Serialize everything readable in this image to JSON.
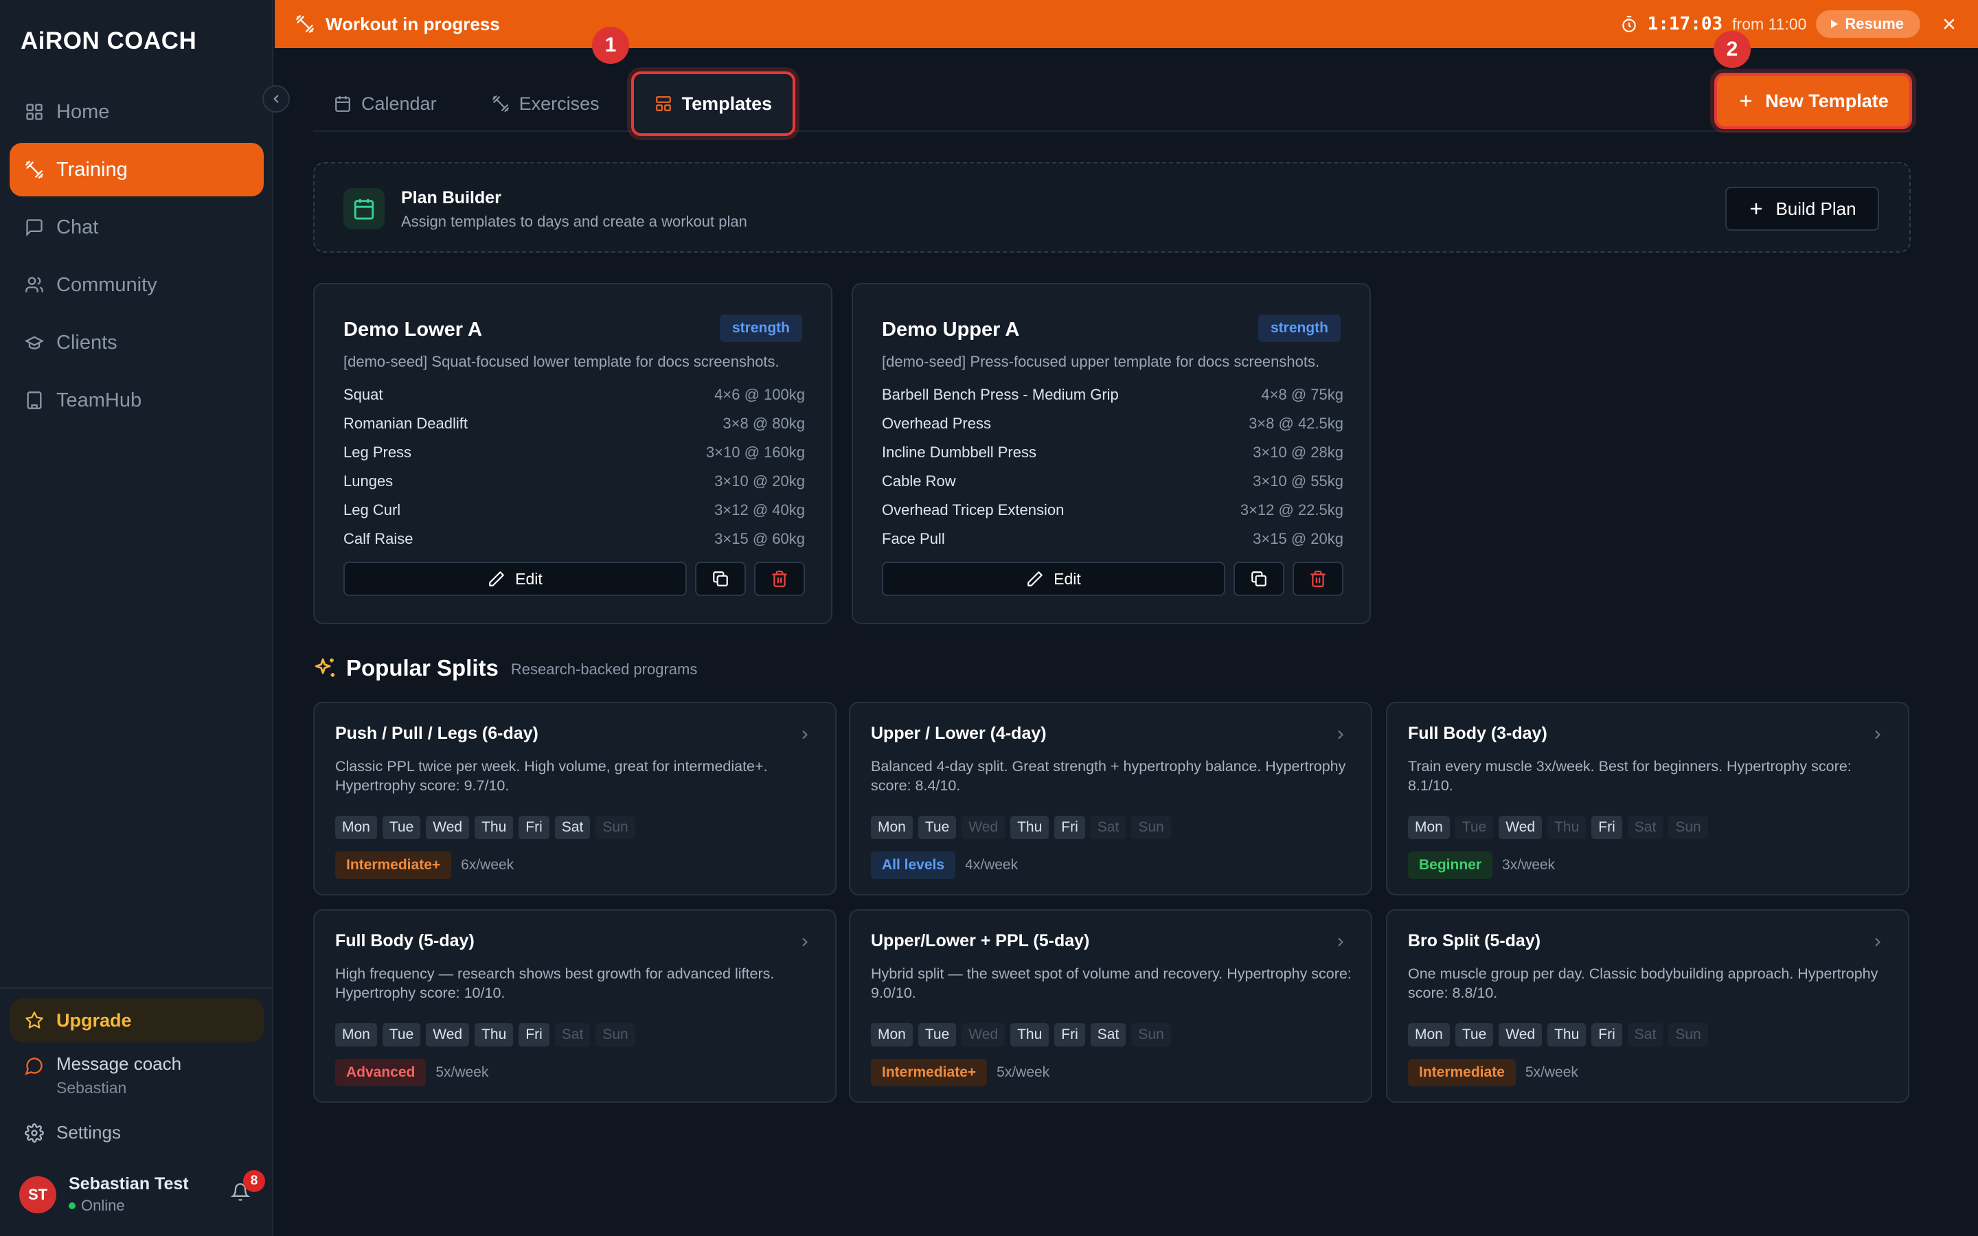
{
  "app": {
    "logo_text": "AiRON COACH"
  },
  "sidebar": {
    "items": [
      {
        "label": "Home",
        "icon": "home-grid-icon",
        "active": false
      },
      {
        "label": "Training",
        "icon": "dumbbell-icon",
        "active": true
      },
      {
        "label": "Chat",
        "icon": "chat-bubble-icon",
        "active": false
      },
      {
        "label": "Community",
        "icon": "users-icon",
        "active": false
      },
      {
        "label": "Clients",
        "icon": "graduation-cap-icon",
        "active": false
      },
      {
        "label": "TeamHub",
        "icon": "building-icon",
        "active": false
      }
    ],
    "upgrade_label": "Upgrade",
    "message_coach": {
      "label": "Message coach",
      "coach_name": "Sebastian"
    },
    "settings_label": "Settings",
    "user": {
      "initials": "ST",
      "name": "Sebastian Test",
      "status": "Online",
      "notification_count": "8"
    }
  },
  "workout_bar": {
    "title": "Workout in progress",
    "timer": "1:17:03",
    "from": "from 11:00",
    "resume_label": "Resume"
  },
  "tabs": [
    {
      "label": "Calendar",
      "icon": "calendar-icon",
      "active": false
    },
    {
      "label": "Exercises",
      "icon": "dumbbell-icon",
      "active": false
    },
    {
      "label": "Templates",
      "icon": "layout-icon",
      "active": true
    }
  ],
  "step_badges": {
    "first": "1",
    "second": "2"
  },
  "new_template_label": "New Template",
  "plan_builder": {
    "title": "Plan Builder",
    "subtitle": "Assign templates to days and create a workout plan",
    "button_label": "Build Plan"
  },
  "templates": [
    {
      "name": "Demo Lower A",
      "tag": "strength",
      "description": "[demo-seed] Squat-focused lower template for docs screenshots.",
      "exercises": [
        {
          "name": "Squat",
          "scheme": "4×6 @ 100kg"
        },
        {
          "name": "Romanian Deadlift",
          "scheme": "3×8 @ 80kg"
        },
        {
          "name": "Leg Press",
          "scheme": "3×10 @ 160kg"
        },
        {
          "name": "Lunges",
          "scheme": "3×10 @ 20kg"
        },
        {
          "name": "Leg Curl",
          "scheme": "3×12 @ 40kg"
        },
        {
          "name": "Calf Raise",
          "scheme": "3×15 @ 60kg"
        }
      ],
      "edit_label": "Edit"
    },
    {
      "name": "Demo Upper A",
      "tag": "strength",
      "description": "[demo-seed] Press-focused upper template for docs screenshots.",
      "exercises": [
        {
          "name": "Barbell Bench Press - Medium Grip",
          "scheme": "4×8 @ 75kg"
        },
        {
          "name": "Overhead Press",
          "scheme": "3×8 @ 42.5kg"
        },
        {
          "name": "Incline Dumbbell Press",
          "scheme": "3×10 @ 28kg"
        },
        {
          "name": "Cable Row",
          "scheme": "3×10 @ 55kg"
        },
        {
          "name": "Overhead Tricep Extension",
          "scheme": "3×12 @ 22.5kg"
        },
        {
          "name": "Face Pull",
          "scheme": "3×15 @ 20kg"
        }
      ],
      "edit_label": "Edit"
    }
  ],
  "popular_splits": {
    "title": "Popular Splits",
    "subtitle": "Research-backed programs",
    "days": [
      "Mon",
      "Tue",
      "Wed",
      "Thu",
      "Fri",
      "Sat",
      "Sun"
    ],
    "items": [
      {
        "name": "Push / Pull / Legs (6-day)",
        "description": "Classic PPL twice per week. High volume, great for intermediate+. Hypertrophy score: 9.7/10.",
        "active_days": [
          true,
          true,
          true,
          true,
          true,
          true,
          false
        ],
        "level": "Intermediate+",
        "level_style": "int",
        "frequency": "6x/week"
      },
      {
        "name": "Upper / Lower (4-day)",
        "description": "Balanced 4-day split. Great strength + hypertrophy balance. Hypertrophy score: 8.4/10.",
        "active_days": [
          true,
          true,
          false,
          true,
          true,
          false,
          false
        ],
        "level": "All levels",
        "level_style": "all",
        "frequency": "4x/week"
      },
      {
        "name": "Full Body (3-day)",
        "description": "Train every muscle 3x/week. Best for beginners. Hypertrophy score: 8.1/10.",
        "active_days": [
          true,
          false,
          true,
          false,
          true,
          false,
          false
        ],
        "level": "Beginner",
        "level_style": "beg",
        "frequency": "3x/week"
      },
      {
        "name": "Full Body (5-day)",
        "description": "High frequency — research shows best growth for advanced lifters. Hypertrophy score: 10/10.",
        "active_days": [
          true,
          true,
          true,
          true,
          true,
          false,
          false
        ],
        "level": "Advanced",
        "level_style": "adv",
        "frequency": "5x/week"
      },
      {
        "name": "Upper/Lower + PPL (5-day)",
        "description": "Hybrid split — the sweet spot of volume and recovery. Hypertrophy score: 9.0/10.",
        "active_days": [
          true,
          true,
          false,
          true,
          true,
          true,
          false
        ],
        "level": "Intermediate+",
        "level_style": "int",
        "frequency": "5x/week"
      },
      {
        "name": "Bro Split (5-day)",
        "description": "One muscle group per day. Classic bodybuilding approach. Hypertrophy score: 8.8/10.",
        "active_days": [
          true,
          true,
          true,
          true,
          true,
          false,
          false
        ],
        "level": "Intermediate",
        "level_style": "int",
        "frequency": "5x/week"
      }
    ]
  },
  "colors": {
    "accent": "#ec5f12",
    "background": "#0f1620",
    "card": "#151d28",
    "highlight_outline": "#e53935"
  }
}
